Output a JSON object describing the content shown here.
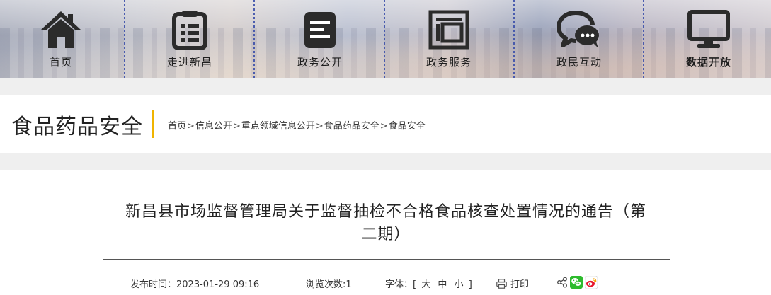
{
  "nav": {
    "items": [
      {
        "label": "首页",
        "icon": "home-icon"
      },
      {
        "label": "走进新昌",
        "icon": "document-list-icon"
      },
      {
        "label": "政务公开",
        "icon": "notebook-icon"
      },
      {
        "label": "政务服务",
        "icon": "service-window-icon"
      },
      {
        "label": "政民互动",
        "icon": "chat-bubbles-icon"
      },
      {
        "label": "数据开放",
        "icon": "monitor-icon"
      }
    ],
    "active_label": "数据开放"
  },
  "section": {
    "title": "食品药品安全",
    "breadcrumb": [
      "首页",
      "信息公开",
      "重点领域信息公开",
      "食品药品安全",
      "食品安全"
    ],
    "breadcrumb_sep": ">"
  },
  "article": {
    "title_line1": "新昌县市场监督管理局关于监督抽检不合格食品核查处置情况的通告（第",
    "title_line2": "二期）",
    "publish_label": "发布时间：",
    "publish_time": "2023-01-29 09:16",
    "views_label": "浏览次数:",
    "views_count": "1",
    "font_label": "字体：[",
    "font_large": "大",
    "font_medium": "中",
    "font_small": "小",
    "font_close": "]",
    "print_label": "打印",
    "share_icons": [
      "share-icon",
      "wechat-icon",
      "weibo-icon"
    ]
  },
  "colors": {
    "accent_separator": "#f0b400",
    "wechat": "#2dbb2d",
    "weibo": "#e6162d",
    "band_grey": "#efefef"
  }
}
